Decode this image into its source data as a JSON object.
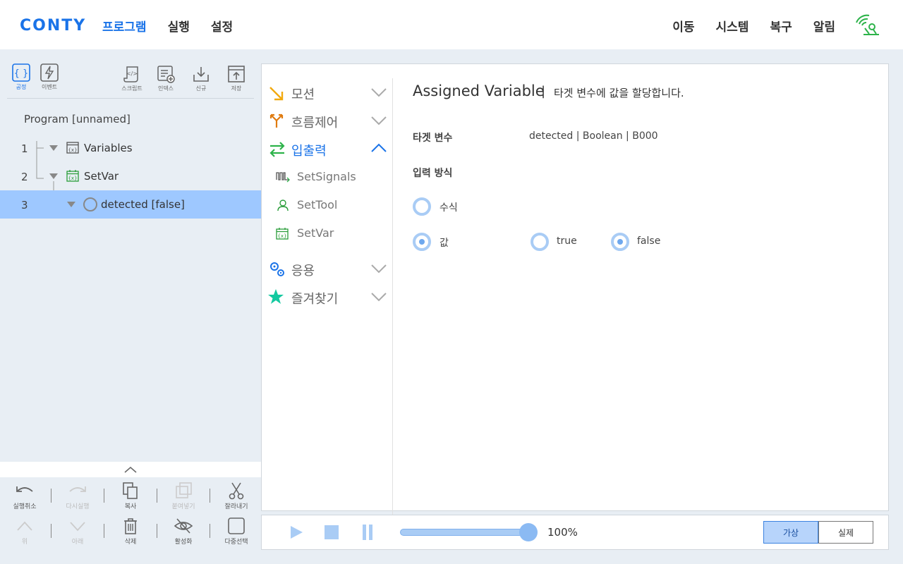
{
  "header": {
    "logo": "CONTY",
    "nav_left": [
      "프로그램",
      "실행",
      "설정"
    ],
    "nav_right": [
      "이동",
      "시스템",
      "복구",
      "알림"
    ],
    "active_nav": "프로그램"
  },
  "toolbar": {
    "process": "공정",
    "event": "이벤트",
    "script": "스크립트",
    "index": "인덱스",
    "new": "신규",
    "save": "저장"
  },
  "tree": {
    "title": "Program [unnamed]",
    "rows": [
      {
        "num": "1",
        "label": "Variables",
        "icon": "variables-icon"
      },
      {
        "num": "2",
        "label": "SetVar",
        "icon": "setvar-icon"
      },
      {
        "num": "3",
        "label": "detected [false]",
        "icon": "circle-icon",
        "selected": true
      }
    ]
  },
  "edit_tools": {
    "undo": "실행취소",
    "redo": "다시실행",
    "copy": "복사",
    "paste": "붙여넣기",
    "cut": "잘라내기",
    "up": "위",
    "down": "아래",
    "delete": "삭제",
    "activate": "활성화",
    "multi_select": "다중선택"
  },
  "commands": {
    "categories": [
      {
        "label": "모션",
        "icon": "motion-arrow-icon",
        "open": false
      },
      {
        "label": "흐름제어",
        "icon": "flow-branch-icon",
        "open": false
      },
      {
        "label": "입출력",
        "icon": "io-arrows-icon",
        "open": true
      },
      {
        "label": "응용",
        "icon": "gears-icon",
        "open": false
      },
      {
        "label": "즐겨찾기",
        "icon": "star-icon",
        "open": false
      }
    ],
    "io_items": [
      "SetSignals",
      "SetTool",
      "SetVar"
    ]
  },
  "detail": {
    "title": "Assigned Variable",
    "separator": "|",
    "description": "타겟 변수에 값을 할당합니다.",
    "target_label": "타겟 변수",
    "target_value": "detected | Boolean | B000",
    "input_method_label": "입력 방식",
    "option_expression": "수식",
    "option_value": "값",
    "selected_option": "값",
    "value_true": "true",
    "value_false": "false",
    "selected_value": "false"
  },
  "playback": {
    "speed_label": "100%",
    "speed": 1.0,
    "mode_virtual": "가상",
    "mode_real": "실제",
    "active_mode": "가상"
  },
  "colors": {
    "accent": "#1a73e8",
    "selected_row": "#9ec8ff",
    "radio": "#a9ccf5"
  }
}
